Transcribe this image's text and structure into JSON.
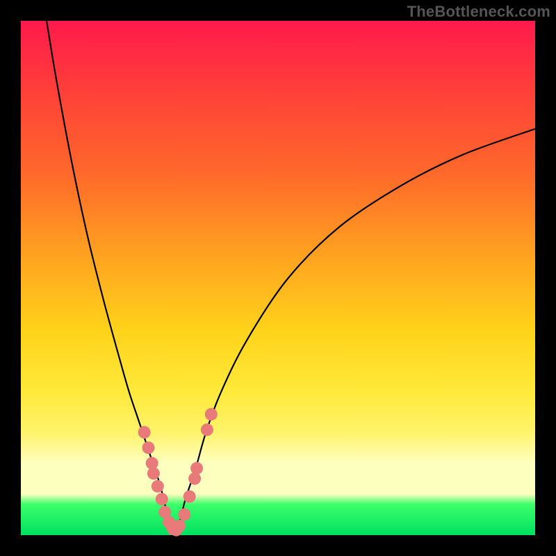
{
  "watermark": "TheBottleneck.com",
  "colors": {
    "frame": "#000000",
    "marker": "#e97a7a",
    "curve": "#000000",
    "gradient_stops": [
      "#ff1a4d",
      "#ff3b3b",
      "#ff6a2a",
      "#ffa020",
      "#ffd21a",
      "#ffe93a",
      "#fff36a",
      "#fdffbf",
      "#3cff6b",
      "#00e060"
    ]
  },
  "chart_data": {
    "type": "line",
    "title": "",
    "xlabel": "",
    "ylabel": "",
    "xlim": [
      0,
      100
    ],
    "ylim": [
      0,
      100
    ],
    "series": [
      {
        "name": "left-branch",
        "x": [
          5,
          7,
          10,
          13,
          16,
          19,
          21,
          23,
          25,
          27,
          28,
          29,
          30
        ],
        "y": [
          100,
          88,
          72,
          58,
          46,
          35,
          28,
          22,
          16,
          10,
          6,
          3,
          0
        ]
      },
      {
        "name": "right-branch",
        "x": [
          30,
          31,
          32,
          34,
          36,
          39,
          44,
          52,
          62,
          74,
          86,
          100
        ],
        "y": [
          0,
          3,
          7,
          13,
          20,
          28,
          38,
          50,
          60,
          68,
          74,
          79
        ]
      }
    ],
    "markers": {
      "name": "data-points",
      "x": [
        24.0,
        24.8,
        25.5,
        25.8,
        26.6,
        27.4,
        28.0,
        28.8,
        29.6,
        30.2,
        30.8,
        31.8,
        32.8,
        33.8,
        34.2,
        36.2,
        37.0
      ],
      "y": [
        20.0,
        17.0,
        14.0,
        12.0,
        9.5,
        7.0,
        4.5,
        2.5,
        1.2,
        1.0,
        1.8,
        4.0,
        7.5,
        11.0,
        13.0,
        20.5,
        23.5
      ]
    },
    "annotations": []
  }
}
